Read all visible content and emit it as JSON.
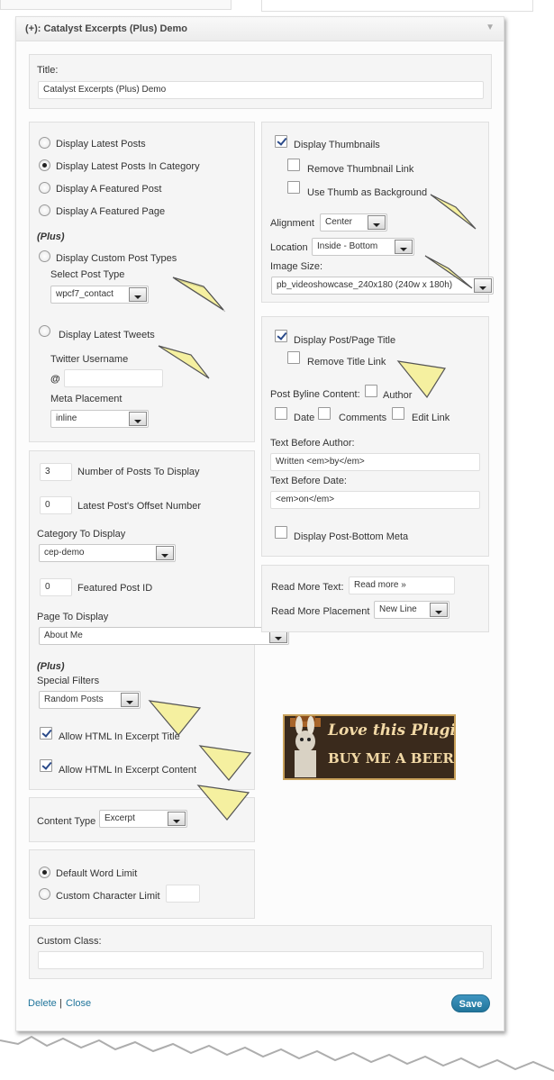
{
  "widget": {
    "title": "(+): Catalyst Excerpts (Plus) Demo",
    "collapse_icon": "triangle-down-icon"
  },
  "title_field": {
    "label": "Title:",
    "value": "Catalyst Excerpts (Plus) Demo"
  },
  "display_mode": {
    "options": [
      {
        "label": "Display Latest Posts",
        "selected": false
      },
      {
        "label": "Display Latest Posts In Category",
        "selected": true
      },
      {
        "label": "Display A Featured Post",
        "selected": false
      },
      {
        "label": "Display A Featured Page",
        "selected": false
      }
    ],
    "plus_label": "(Plus)",
    "custom_post_types_label": "Display Custom Post Types",
    "select_post_type_label": "Select Post Type",
    "post_type_value": "wpcf7_contact",
    "latest_tweets_label": "Display Latest Tweets",
    "twitter_username_label": "Twitter Username",
    "at_sign": "@",
    "twitter_username_value": "",
    "meta_placement_label": "Meta Placement",
    "meta_placement_value": "inline"
  },
  "thumbnails": {
    "display_label": "Display Thumbnails",
    "display_checked": true,
    "remove_link_label": "Remove Thumbnail Link",
    "remove_link_checked": false,
    "use_bg_label": "Use Thumb as Background",
    "use_bg_checked": false,
    "alignment_label": "Alignment",
    "alignment_value": "Center",
    "location_label": "Location",
    "location_value": "Inside - Bottom",
    "image_size_label": "Image Size:",
    "image_size_value": "pb_videoshowcase_240x180 (240w x 180h)"
  },
  "post_title": {
    "display_label": "Display Post/Page Title",
    "display_checked": true,
    "remove_link_label": "Remove Title Link",
    "remove_link_checked": false,
    "byline_label": "Post Byline Content:",
    "author_label": "Author",
    "date_label": "Date",
    "comments_label": "Comments",
    "edit_link_label": "Edit Link",
    "text_before_author_label": "Text Before Author:",
    "text_before_author_value": "Written <em>by</em>",
    "text_before_date_label": "Text Before Date:",
    "text_before_date_value": "<em>on</em>",
    "bottom_meta_label": "Display Post-Bottom Meta",
    "bottom_meta_checked": false
  },
  "posts_settings": {
    "num_posts_value": "3",
    "num_posts_label": "Number of Posts To Display",
    "offset_value": "0",
    "offset_label": "Latest Post's Offset Number",
    "category_label": "Category To Display",
    "category_value": "cep-demo",
    "featured_id_value": "0",
    "featured_id_label": "Featured Post ID",
    "page_label": "Page To Display",
    "page_value": "About Me",
    "plus_label": "(Plus)",
    "special_filters_label": "Special Filters",
    "special_filters_value": "Random Posts",
    "html_title_label": "Allow HTML In Excerpt Title",
    "html_title_checked": true,
    "html_content_label": "Allow HTML In Excerpt Content",
    "html_content_checked": true
  },
  "read_more": {
    "text_label": "Read More Text:",
    "text_value": "Read more »",
    "placement_label": "Read More Placement",
    "placement_value": "New Line"
  },
  "content_type": {
    "label": "Content Type",
    "value": "Excerpt"
  },
  "limit": {
    "default_label": "Default Word Limit",
    "default_selected": true,
    "custom_label": "Custom Character Limit",
    "custom_selected": false,
    "custom_value": ""
  },
  "custom_class": {
    "label": "Custom Class:",
    "value": ""
  },
  "footer": {
    "delete_label": "Delete",
    "separator": "|",
    "close_label": "Close",
    "save_label": "Save"
  },
  "beer_banner": {
    "line1": "Love this Plugin?",
    "line2": "BUY ME A BEER!"
  },
  "colors": {
    "link": "#21759b",
    "save_button": "#21759b",
    "pointer": "#f5f0a0"
  }
}
